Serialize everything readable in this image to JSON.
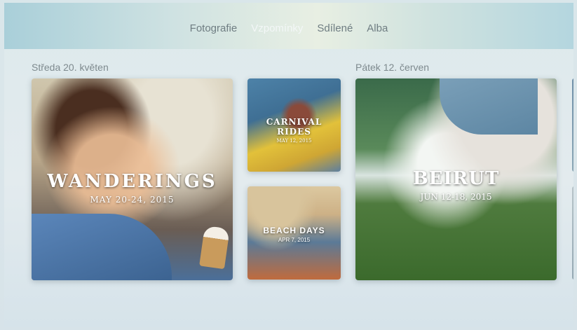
{
  "nav": {
    "tabs": [
      {
        "label": "Fotografie",
        "active": false
      },
      {
        "label": "Vzpomínky",
        "active": true
      },
      {
        "label": "Sdílené",
        "active": false
      },
      {
        "label": "Alba",
        "active": false
      }
    ]
  },
  "sections": [
    {
      "date": "Středa 20. květen",
      "cards": [
        {
          "title": "WANDERINGS",
          "date": "MAY 20-24, 2015"
        },
        {
          "title": "CARNIVAL RIDES",
          "date": "MAY 12, 2015"
        },
        {
          "title": "BEACH DAYS",
          "date": "APR 7, 2015"
        }
      ]
    },
    {
      "date": "Pátek 12. červen",
      "cards": [
        {
          "title": "BEIRUT",
          "date": "JUN 12-18, 2015"
        }
      ]
    }
  ]
}
